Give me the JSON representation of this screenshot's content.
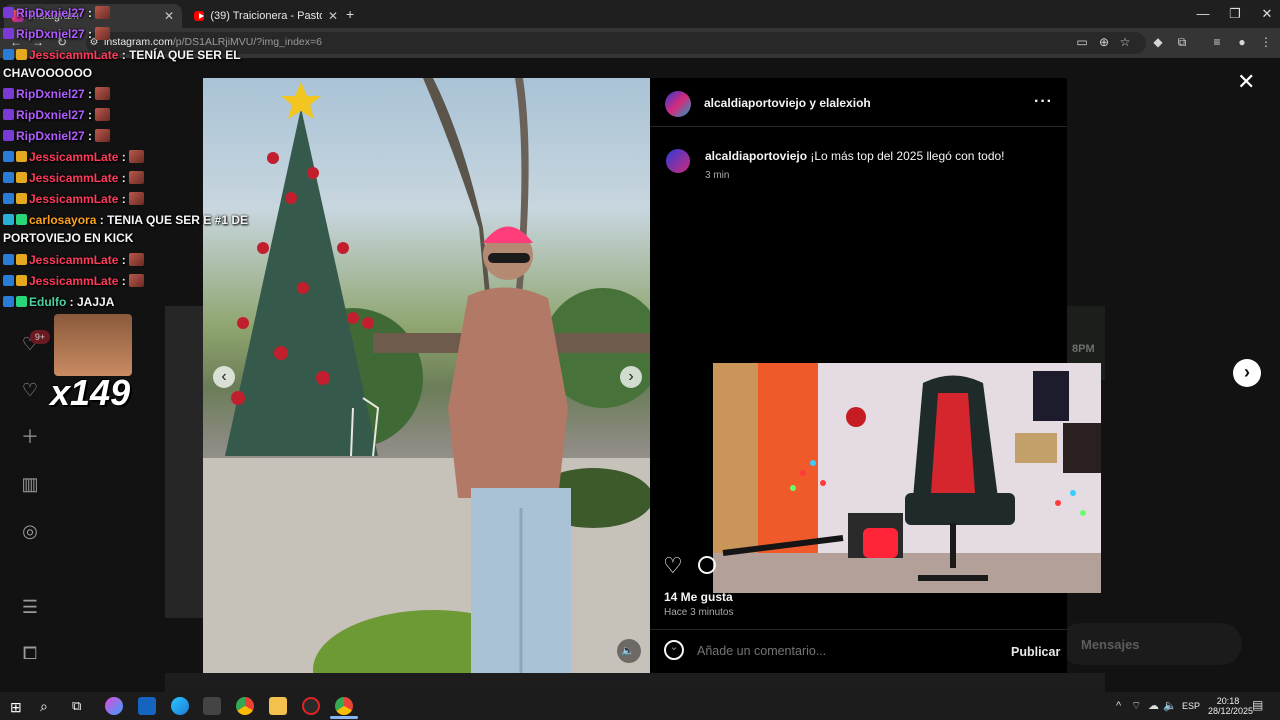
{
  "browser": {
    "tabs": [
      {
        "label": "Instagram",
        "active": true
      },
      {
        "label": "(39) Traicionera - Pastor López",
        "active": false
      }
    ],
    "new_tab": "+",
    "url_host": "instagram.com",
    "url_path": "/p/DS1ALRjiMVU/?img_index=6",
    "window_controls": [
      "—",
      "❐",
      "✕"
    ]
  },
  "post": {
    "header_accounts": "alcaldiaportoviejo y elalexioh",
    "caption_user": "alcaldiaportoviejo",
    "caption_text": "¡Lo más top del 2025 llegó con todo!",
    "caption_time": "3 min",
    "likes": "14 Me gusta",
    "time_ago": "Hace 3 minutos",
    "comment_placeholder": "Añade un comentario...",
    "publish_label": "Publicar",
    "more_icon": "···",
    "close_icon": "✕",
    "next_icon": "›",
    "prev_icon": "‹"
  },
  "background": {
    "messages_label": "Mensajes",
    "time_label": "8PM",
    "notif_count": "9+"
  },
  "chat": {
    "lines": [
      {
        "user": "RipDxniel27",
        "sep": " :",
        "text": "",
        "color": "u-purple"
      },
      {
        "user": "RipDxniel27",
        "sep": " :",
        "text": "",
        "color": "u-purple"
      },
      {
        "user": "JessicammLate",
        "sep": " :",
        "text": " TENÍA QUE SER EL",
        "color": "u-red"
      },
      {
        "user": "",
        "sep": "",
        "text": "CHAVOOOOOO",
        "color": "u-red"
      },
      {
        "user": "RipDxniel27",
        "sep": " :",
        "text": "",
        "color": "u-purple"
      },
      {
        "user": "RipDxniel27",
        "sep": " :",
        "text": "",
        "color": "u-purple"
      },
      {
        "user": "RipDxniel27",
        "sep": " :",
        "text": "",
        "color": "u-purple"
      },
      {
        "user": "JessicammLate",
        "sep": " :",
        "text": "",
        "color": "u-red"
      },
      {
        "user": "JessicammLate",
        "sep": " :",
        "text": "",
        "color": "u-red"
      },
      {
        "user": "JessicammLate",
        "sep": " :",
        "text": "",
        "color": "u-red"
      },
      {
        "user": "carlosayora",
        "sep": " :",
        "text": " TENIA QUE SER E #1 DE",
        "color": "u-orange"
      },
      {
        "user": "",
        "sep": "",
        "text": "PORTOVIEJO EN KICK",
        "color": "u-orange"
      },
      {
        "user": "JessicammLate",
        "sep": " :",
        "text": "",
        "color": "u-red"
      },
      {
        "user": "JessicammLate",
        "sep": " :",
        "text": "",
        "color": "u-red"
      },
      {
        "user": "Edulfo",
        "sep": " :",
        "text": " JAJJA",
        "color": "u-green"
      }
    ],
    "combo": "x149"
  },
  "taskbar": {
    "lang": "ESP",
    "time": "20:18",
    "date": "28/12/2025",
    "tray_up": "^"
  },
  "colors": {
    "instagram_blue": "#0095f6",
    "chrome_dark": "#1f1f1f",
    "overlay_bg": "#121212"
  }
}
